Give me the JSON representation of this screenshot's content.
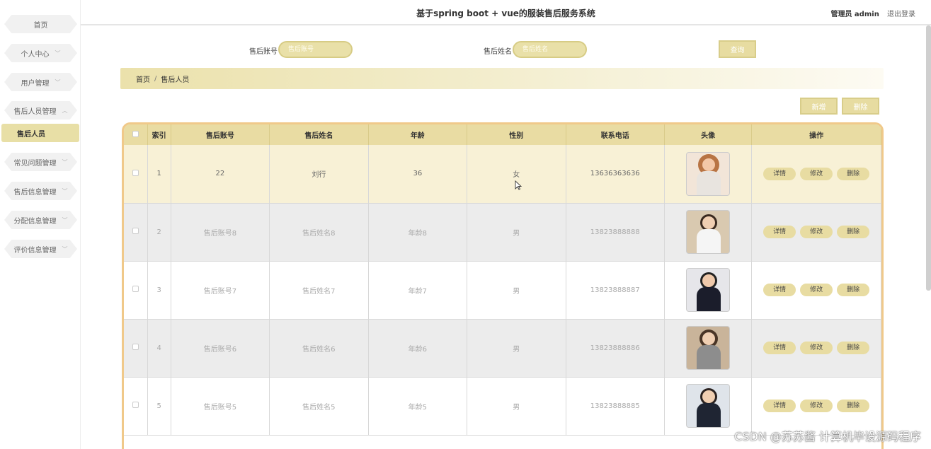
{
  "app": {
    "title": "基于spring boot + vue的服装售后服务系统",
    "user_label": "管理员 admin",
    "logout_label": "退出登录"
  },
  "sidebar": {
    "items": [
      {
        "label": "首页",
        "chevron": ""
      },
      {
        "label": "个人中心",
        "chevron": "﹀"
      },
      {
        "label": "用户管理",
        "chevron": "﹀"
      },
      {
        "label": "售后人员管理",
        "chevron": "︿"
      },
      {
        "label": "售后人员",
        "chevron": ""
      },
      {
        "label": "常见问题管理",
        "chevron": "﹀"
      },
      {
        "label": "售后信息管理",
        "chevron": "﹀"
      },
      {
        "label": "分配信息管理",
        "chevron": "﹀"
      },
      {
        "label": "评价信息管理",
        "chevron": "﹀"
      }
    ]
  },
  "search": {
    "account_label": "售后账号",
    "account_placeholder": "售后账号",
    "name_label": "售后姓名",
    "name_placeholder": "售后姓名",
    "query_button": "查询"
  },
  "breadcrumb": {
    "home": "首页",
    "separator": "/",
    "current": "售后人员"
  },
  "toolbar": {
    "add_button": "新增",
    "delete_button": "删除"
  },
  "table": {
    "headers": [
      "索引",
      "售后账号",
      "售后姓名",
      "年龄",
      "性别",
      "联系电话",
      "头像",
      "操作"
    ],
    "rows": [
      {
        "index": "1",
        "account": "22",
        "name": "刘行",
        "age": "36",
        "gender": "女",
        "phone": "13636363636",
        "avatar": "female-avatar"
      },
      {
        "index": "2",
        "account": "售后账号8",
        "name": "售后姓名8",
        "age": "年龄8",
        "gender": "男",
        "phone": "13823888888",
        "avatar": "female-avatar"
      },
      {
        "index": "3",
        "account": "售后账号7",
        "name": "售后姓名7",
        "age": "年龄7",
        "gender": "男",
        "phone": "13823888887",
        "avatar": "male-avatar"
      },
      {
        "index": "4",
        "account": "售后账号6",
        "name": "售后姓名6",
        "age": "年龄6",
        "gender": "男",
        "phone": "13823888886",
        "avatar": "female-avatar"
      },
      {
        "index": "5",
        "account": "售后账号5",
        "name": "售后姓名5",
        "age": "年龄5",
        "gender": "男",
        "phone": "13823888885",
        "avatar": "female-avatar"
      }
    ],
    "actions": {
      "detail": "详情",
      "edit": "修改",
      "delete": "删除"
    }
  },
  "watermark": "CSDN @苏苏酱   计算机毕设源码程序",
  "colors": {
    "accent": "#e8dca2",
    "table_border": "#f0c98a",
    "active_row": "#f8f1d6"
  }
}
